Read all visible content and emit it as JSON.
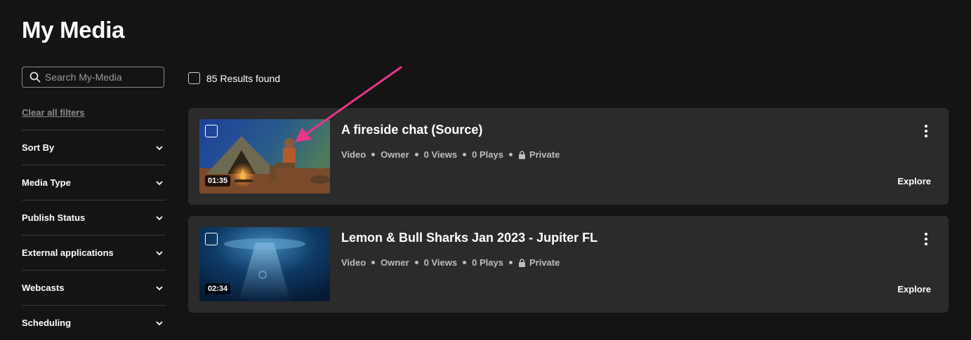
{
  "page": {
    "title": "My Media"
  },
  "search": {
    "placeholder": "Search My-Media",
    "value": ""
  },
  "sidebar": {
    "clear_filters": "Clear all filters",
    "filters": [
      {
        "label": "Sort By"
      },
      {
        "label": "Media Type"
      },
      {
        "label": "Publish Status"
      },
      {
        "label": "External applications"
      },
      {
        "label": "Webcasts"
      },
      {
        "label": "Scheduling"
      }
    ]
  },
  "results": {
    "count_text": "85 Results found"
  },
  "media": [
    {
      "title": "A fireside chat (Source)",
      "duration": "01:35",
      "type": "Video",
      "role": "Owner",
      "views": "0 Views",
      "plays": "0 Plays",
      "privacy": "Private",
      "action": "Explore"
    },
    {
      "title": "Lemon & Bull Sharks Jan 2023 - Jupiter FL",
      "duration": "02:34",
      "type": "Video",
      "role": "Owner",
      "views": "0 Views",
      "plays": "0 Plays",
      "privacy": "Private",
      "action": "Explore"
    }
  ],
  "colors": {
    "background": "#141414",
    "card": "#2b2b2b",
    "annotation_arrow": "#e8368a"
  }
}
